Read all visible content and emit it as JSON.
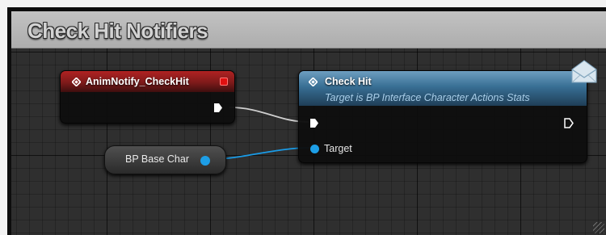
{
  "comment": {
    "title": "Check Hit Notifiers"
  },
  "event_node": {
    "title": "AnimNotify_CheckHit"
  },
  "function_node": {
    "title": "Check Hit",
    "subtitle": "Target is BP Interface Character Actions Stats",
    "target_pin_label": "Target"
  },
  "variable_node": {
    "label": "BP Base Char"
  },
  "colors": {
    "event_header": "#a41f1f",
    "function_header": "#4f87b0",
    "object_pin": "#1d9ee6",
    "exec_wire": "#d0d0d0",
    "comment_header": "#b8b8b8"
  },
  "icons": [
    "event-diamond-icon",
    "function-diamond-icon",
    "stop-icon",
    "message-icon",
    "exec-pin-icon",
    "object-pin-icon"
  ]
}
